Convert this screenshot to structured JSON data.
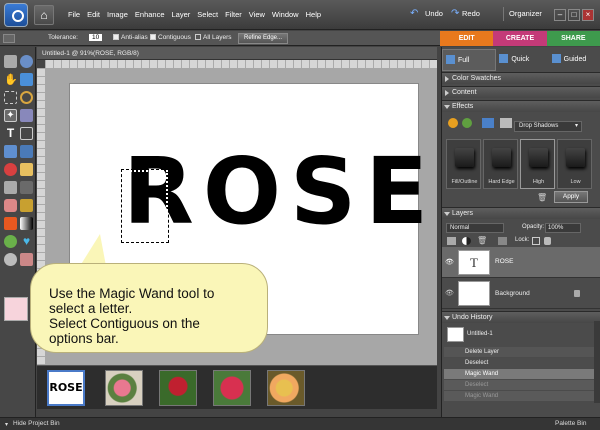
{
  "menubar": {
    "items": [
      "File",
      "Edit",
      "Image",
      "Enhance",
      "Layer",
      "Select",
      "Filter",
      "View",
      "Window",
      "Help"
    ],
    "undo_label": "Undo",
    "redo_label": "Redo",
    "organizer_label": "Organizer"
  },
  "options_bar": {
    "tolerance_label": "Tolerance:",
    "tolerance_value": "10",
    "anti_alias_label": "Anti-alias",
    "contiguous_label": "Contiguous",
    "all_layers_label": "All Layers",
    "refine_edge_label": "Refine Edge..."
  },
  "mode_tabs": [
    {
      "label": "EDIT",
      "color": "#e8791d"
    },
    {
      "label": "CREATE",
      "color": "#c43a78"
    },
    {
      "label": "SHARE",
      "color": "#3e9a4d"
    }
  ],
  "document": {
    "tab_title": "Untitled-1 @ 91%(ROSE, RGB/8)",
    "canvas_text": "ROSE"
  },
  "callout": {
    "line1": "Use the Magic Wand tool to",
    "line2": "select a letter.",
    "line3": "Select Contiguous on the",
    "line4": "options bar."
  },
  "project_bin": {
    "first_thumb_text": "ROSE"
  },
  "statusbar": {
    "hide_bin_label": "Hide Project Bin",
    "palette_bin_label": "Palette Bin"
  },
  "panels": {
    "view_tabs": [
      "Full",
      "Quick",
      "Guided"
    ],
    "color_swatches_label": "Color Swatches",
    "content_label": "Content",
    "effects_label": "Effects",
    "effects_dropdown_value": "Drop Shadows",
    "effects": [
      "Fill/Outline",
      "Hard Edge",
      "High",
      "Low"
    ],
    "apply_label": "Apply",
    "layers_label": "Layers",
    "blend_mode": "Normal",
    "opacity_label": "Opacity:",
    "opacity_value": "100%",
    "lock_label": "Lock:",
    "layers": [
      {
        "name": "ROSE",
        "thumb": "T"
      },
      {
        "name": "Background",
        "thumb": ""
      }
    ],
    "undo_history_label": "Undo History",
    "history": [
      "Untitled-1",
      "Delete Layer",
      "Deselect",
      "Magic Wand",
      "Deselect",
      "Magic Wand"
    ]
  }
}
